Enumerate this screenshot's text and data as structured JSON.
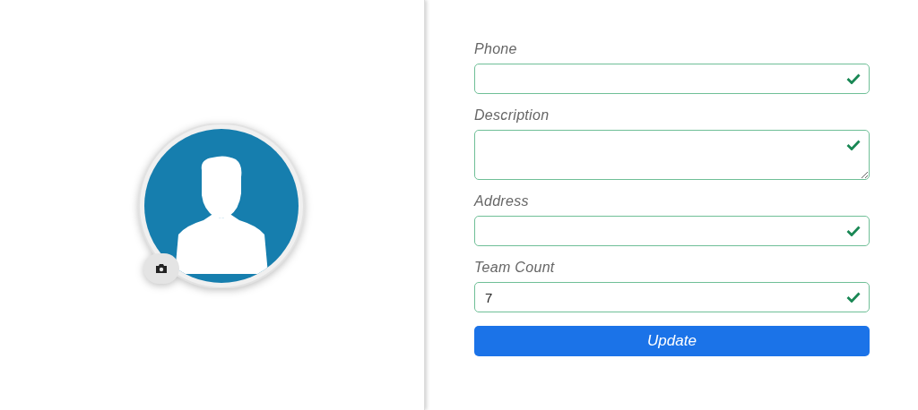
{
  "fields": [
    {
      "kind": "input",
      "label": "Phone",
      "valid": true
    },
    {
      "kind": "textarea",
      "label": "Description",
      "valid": true
    },
    {
      "kind": "input",
      "label": "Address",
      "valid": true
    },
    {
      "kind": "input",
      "label": "Team Count",
      "value": "7",
      "valid": true
    }
  ],
  "submit": {
    "label": "Update"
  }
}
